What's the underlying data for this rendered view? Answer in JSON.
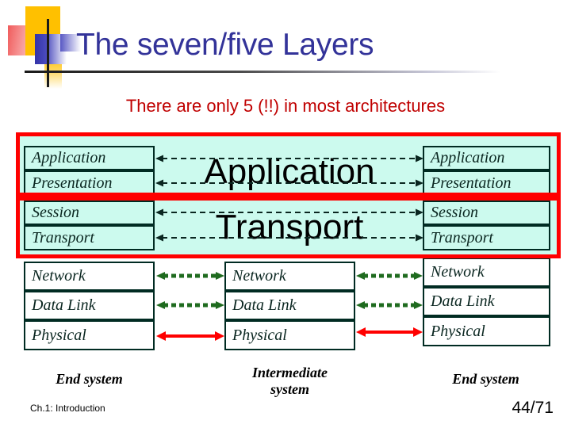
{
  "slide": {
    "title": "The seven/five Layers",
    "subtitle": "There are only 5 (!!) in most architectures",
    "footer_left": "Ch.1: Introduction",
    "page_number": "44/71"
  },
  "colors": {
    "title": "#333399",
    "subtitle": "#C00000",
    "cyan_fill": "#CCFAEE",
    "cell_border": "#002B22",
    "highlight_box": "#FF0000",
    "green_arrow": "#1F6B1F",
    "red_arrow": "#FF0000",
    "dashed_arrow": "#0A2620"
  },
  "diagram": {
    "left_stack": {
      "caption": "End system",
      "layers": [
        {
          "label": "Application",
          "fill": "cyan"
        },
        {
          "label": "Presentation",
          "fill": "cyan"
        },
        {
          "label": "Session",
          "fill": "cyan"
        },
        {
          "label": "Transport",
          "fill": "cyan"
        },
        {
          "label": "Network",
          "fill": "white"
        },
        {
          "label": "Data Link",
          "fill": "white"
        },
        {
          "label": "Physical",
          "fill": "white"
        }
      ]
    },
    "middle_stack": {
      "caption_line1": "Intermediate",
      "caption_line2": "system",
      "big_labels": [
        "Application",
        "Transport"
      ],
      "layers": [
        {
          "label": "Network",
          "fill": "white"
        },
        {
          "label": "Data Link",
          "fill": "white"
        },
        {
          "label": "Physical",
          "fill": "white"
        }
      ]
    },
    "right_stack": {
      "caption": "End system",
      "layers": [
        {
          "label": "Application",
          "fill": "cyan"
        },
        {
          "label": "Presentation",
          "fill": "cyan"
        },
        {
          "label": "Session",
          "fill": "cyan"
        },
        {
          "label": "Transport",
          "fill": "cyan"
        },
        {
          "label": "Network",
          "fill": "white"
        },
        {
          "label": "Data Link",
          "fill": "white"
        },
        {
          "label": "Physical",
          "fill": "white"
        }
      ]
    },
    "highlight_boxes": [
      {
        "name": "application-layer-group",
        "layers": [
          "Application",
          "Presentation"
        ]
      },
      {
        "name": "transport-layer-group",
        "layers": [
          "Session",
          "Transport"
        ]
      }
    ],
    "connections": [
      {
        "style": "dashed",
        "layer": "Application",
        "span": "end-to-end"
      },
      {
        "style": "dashed",
        "layer": "Presentation",
        "span": "end-to-end"
      },
      {
        "style": "dashed",
        "layer": "Session",
        "span": "end-to-end"
      },
      {
        "style": "dashed",
        "layer": "Transport",
        "span": "end-to-end"
      },
      {
        "style": "green-dotted",
        "layer": "Network",
        "span": "hop-by-hop"
      },
      {
        "style": "green-dotted",
        "layer": "Data Link",
        "span": "hop-by-hop"
      },
      {
        "style": "red-solid",
        "layer": "Physical",
        "span": "hop-by-hop"
      }
    ]
  }
}
